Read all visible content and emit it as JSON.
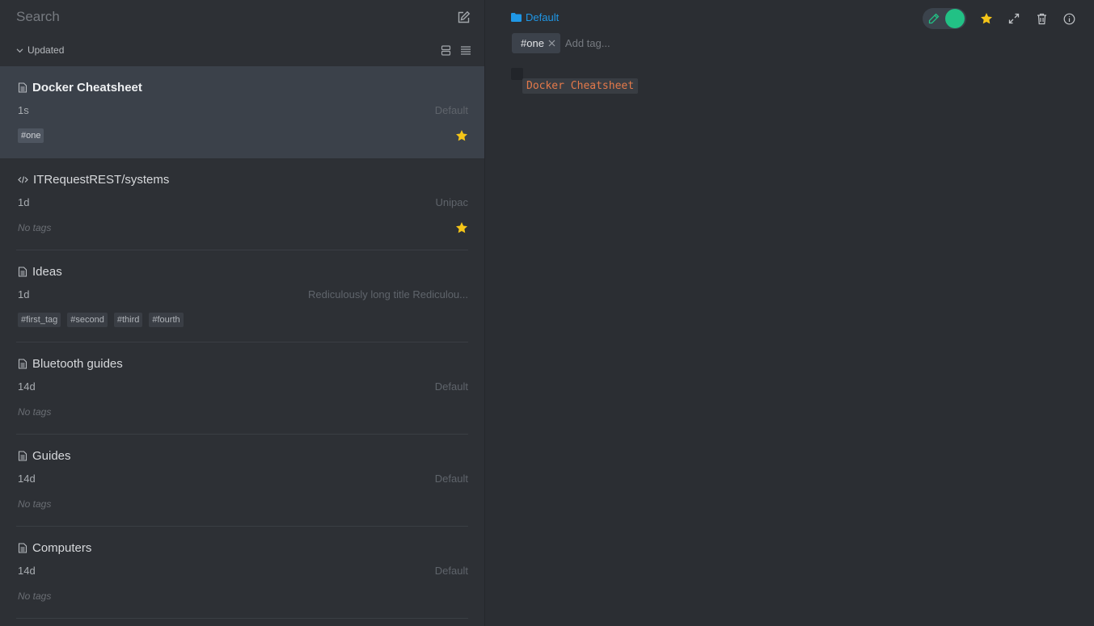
{
  "search": {
    "placeholder": "Search"
  },
  "sort": {
    "label": "Updated"
  },
  "notes": [
    {
      "title": "Docker Cheatsheet",
      "icon": "note-icon",
      "time": "1s",
      "folder": "Default",
      "tags": [
        "#one"
      ],
      "favorite": true,
      "selected": true
    },
    {
      "title": "ITRequestREST/systems",
      "icon": "code-icon",
      "time": "1d",
      "folder": "Unipac",
      "tags": [],
      "no_tags_label": "No tags",
      "favorite": true
    },
    {
      "title": "Ideas",
      "icon": "note-icon",
      "time": "1d",
      "folder": "Rediculously long title Rediculou...",
      "tags": [
        "#first_tag",
        "#second",
        "#third",
        "#fourth"
      ],
      "favorite": false
    },
    {
      "title": "Bluetooth guides",
      "icon": "note-icon",
      "time": "14d",
      "folder": "Default",
      "tags": [],
      "no_tags_label": "No tags",
      "favorite": false
    },
    {
      "title": "Guides",
      "icon": "note-icon",
      "time": "14d",
      "folder": "Default",
      "tags": [],
      "no_tags_label": "No tags",
      "favorite": false
    },
    {
      "title": "Computers",
      "icon": "note-icon",
      "time": "14d",
      "folder": "Default",
      "tags": [],
      "no_tags_label": "No tags",
      "favorite": false
    }
  ],
  "editor": {
    "folder": "Default",
    "tags": [
      "#one"
    ],
    "tag_input_placeholder": "Add tag...",
    "content_code": "Docker Cheatsheet"
  },
  "colors": {
    "accent_blue": "#1f97e6",
    "toggle_green": "#22c185",
    "star_yellow": "#f5c518",
    "code_orange": "#e4794a"
  }
}
